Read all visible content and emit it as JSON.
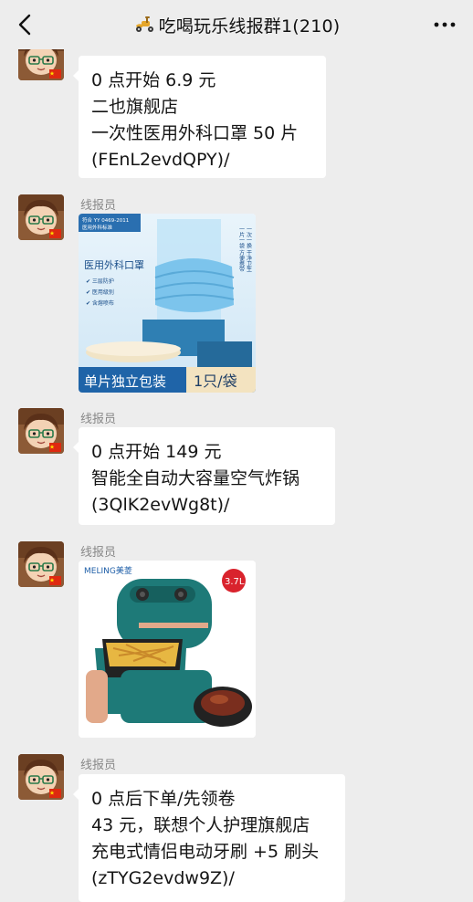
{
  "header": {
    "title": "吃喝玩乐线报群1(210)",
    "back_icon": "chevron-left-icon",
    "more_icon": "more-horizontal-icon",
    "title_icon": "scooter-icon"
  },
  "messages": [
    {
      "sender": "",
      "lines": [
        "0 点开始 6.9 元",
        "二也旗舰店",
        "一次性医用外科口罩 50 片",
        "(FEnL2evdQPY)/"
      ]
    },
    {
      "sender": "线报员",
      "image": {
        "type": "mask-product",
        "top_tag": "符合 YY 0469-2011\n医用外科标准",
        "heading": "医用外科口罩",
        "features": [
          "三层防护",
          "医用级别",
          "含熔喷布"
        ],
        "side_text": "一次一换 干净卫生\n一片一袋 方便携带",
        "banner_left": "单片独立包装",
        "banner_right": "1只/袋"
      }
    },
    {
      "sender": "线报员",
      "lines": [
        "0 点开始 149 元",
        "智能全自动大容量空气炸锅",
        "(3QlK2evWg8t)/"
      ]
    },
    {
      "sender": "线报员",
      "image": {
        "type": "airfryer-product",
        "brand": "MELING美菱",
        "capacity_badge": "3.7L"
      }
    },
    {
      "sender": "线报员",
      "lines": [
        "0 点后下单/先领卷",
        "43 元，联想个人护理旗舰店",
        "充电式情侣电动牙刷 +5 刷头",
        "(zTYG2evdw9Z)/"
      ]
    }
  ],
  "colors": {
    "background": "#ededed",
    "bubble": "#ffffff",
    "mask_blue": "#6bb8e8",
    "fryer_teal": "#1e7a78",
    "banner_blue": "#2a6fb0"
  }
}
